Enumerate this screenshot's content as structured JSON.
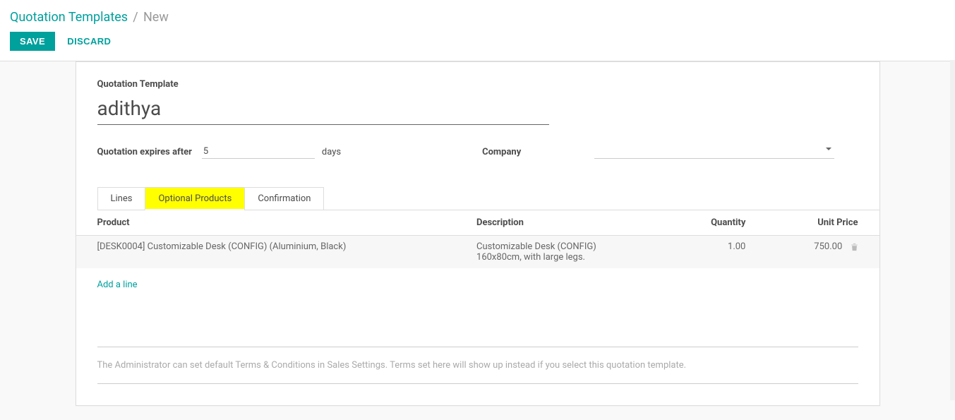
{
  "breadcrumb": {
    "root": "Quotation Templates",
    "current": "New"
  },
  "buttons": {
    "save": "SAVE",
    "discard": "DISCARD"
  },
  "form": {
    "name_label": "Quotation Template",
    "name_value": "adithya",
    "expire_label": "Quotation expires after",
    "expire_value": "5",
    "expire_unit": "days",
    "company_label": "Company",
    "company_value": ""
  },
  "tabs": {
    "lines": "Lines",
    "optional": "Optional Products",
    "confirmation": "Confirmation"
  },
  "table": {
    "headers": {
      "product": "Product",
      "description": "Description",
      "quantity": "Quantity",
      "unit_price": "Unit Price"
    },
    "rows": [
      {
        "product": "[DESK0004] Customizable Desk (CONFIG) (Aluminium, Black)",
        "description": "Customizable Desk (CONFIG)\n160x80cm, with large legs.",
        "quantity": "1.00",
        "unit_price": "750.00"
      }
    ],
    "add_line": "Add a line"
  },
  "terms_placeholder": "The Administrator can set default Terms & Conditions in Sales Settings. Terms set here will show up instead if you select this quotation template."
}
